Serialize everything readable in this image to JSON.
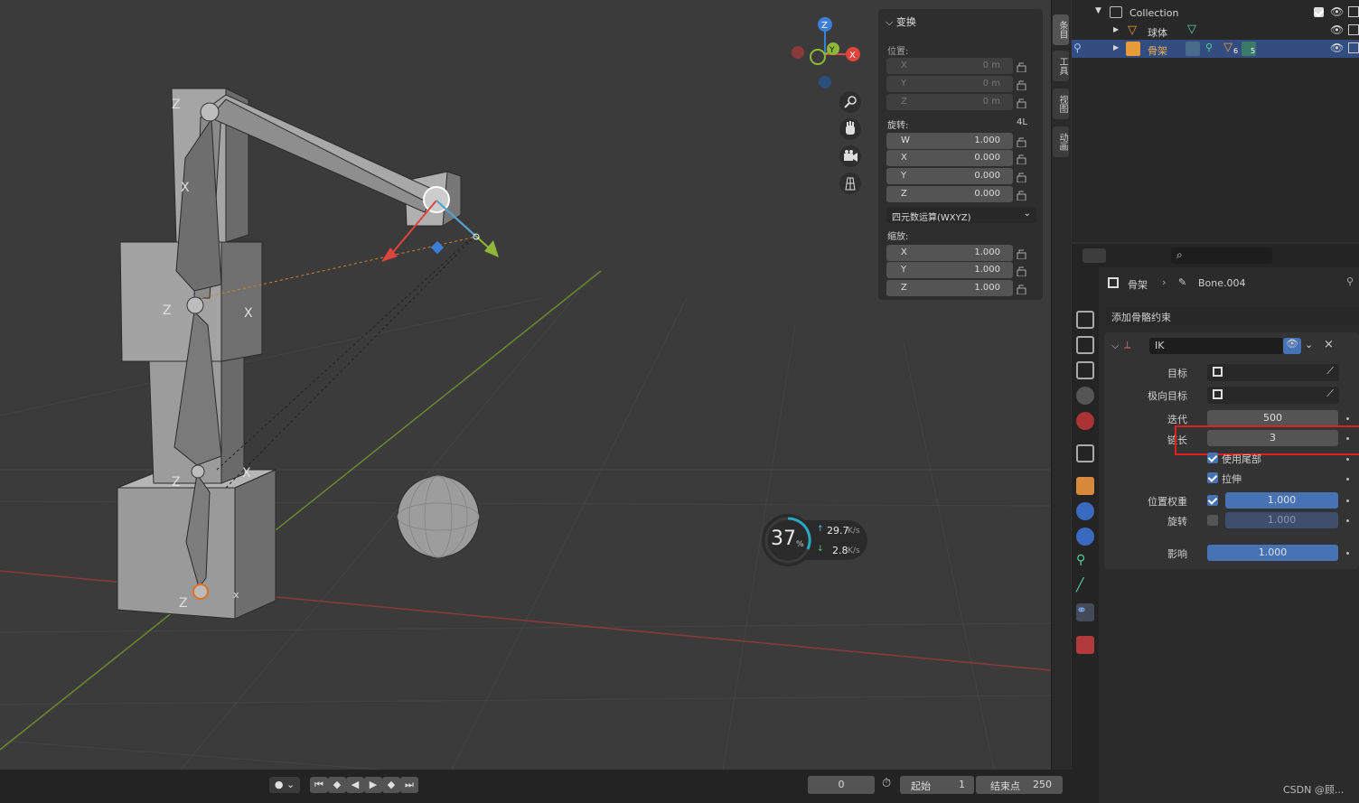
{
  "colors": {
    "accent": "#4772b3",
    "selection": "#334d80",
    "highlight_box": "#e0201c",
    "x_axis": "#e0443c",
    "y_axis": "#8fb83a",
    "z_axis": "#3b7fd8"
  },
  "gizmo": {
    "z": "Z",
    "y": "Y",
    "x": "X"
  },
  "scene": {
    "axis_labels": [
      "Z",
      "X",
      "Z",
      "X",
      "Z",
      "X",
      "Z",
      "x"
    ]
  },
  "npanel": {
    "header": "变换",
    "location_label": "位置:",
    "location": [
      {
        "axis": "X",
        "value": "0 m"
      },
      {
        "axis": "Y",
        "value": "0 m"
      },
      {
        "axis": "Z",
        "value": "0 m"
      }
    ],
    "rotation_label": "旋转:",
    "rotation_mode_short": "4L",
    "rotation": [
      {
        "axis": "W",
        "value": "1.000"
      },
      {
        "axis": "X",
        "value": "0.000"
      },
      {
        "axis": "Y",
        "value": "0.000"
      },
      {
        "axis": "Z",
        "value": "0.000"
      }
    ],
    "rotation_mode": "四元数运算(WXYZ)",
    "scale_label": "缩放:",
    "scale": [
      {
        "axis": "X",
        "value": "1.000"
      },
      {
        "axis": "Y",
        "value": "1.000"
      },
      {
        "axis": "Z",
        "value": "1.000"
      }
    ]
  },
  "side_tabs": [
    "条目",
    "工具",
    "视图",
    "动画"
  ],
  "outliner": {
    "rows": [
      {
        "name": "Collection"
      },
      {
        "name": "球体"
      },
      {
        "name": "骨架",
        "badge1": "6",
        "badge2": "5"
      }
    ]
  },
  "properties": {
    "breadcrumb": {
      "object": "骨架",
      "bone": "Bone.004"
    },
    "add_constraint": "添加骨骼约束",
    "constraint_name": "IK",
    "target_label": "目标",
    "pole_target_label": "极向目标",
    "iterations_label": "迭代",
    "iterations": "500",
    "chain_length_label": "链长",
    "chain_length": "3",
    "use_tail_label": "使用尾部",
    "stretch_label": "拉伸",
    "weight_position_label": "位置权重",
    "weight_position": "1.000",
    "rotation_label": "旋转",
    "rotation_weight": "1.000",
    "influence_label": "影响",
    "influence": "1.000"
  },
  "netspeed": {
    "percent": "37",
    "percent_unit": "%",
    "up": "29.7",
    "down": "2.8",
    "unit": "K/s"
  },
  "timeline": {
    "current_frame": "0",
    "start_label": "起始",
    "start": "1",
    "end_label": "结束点",
    "end": "250"
  },
  "watermark": "CSDN @顾..."
}
